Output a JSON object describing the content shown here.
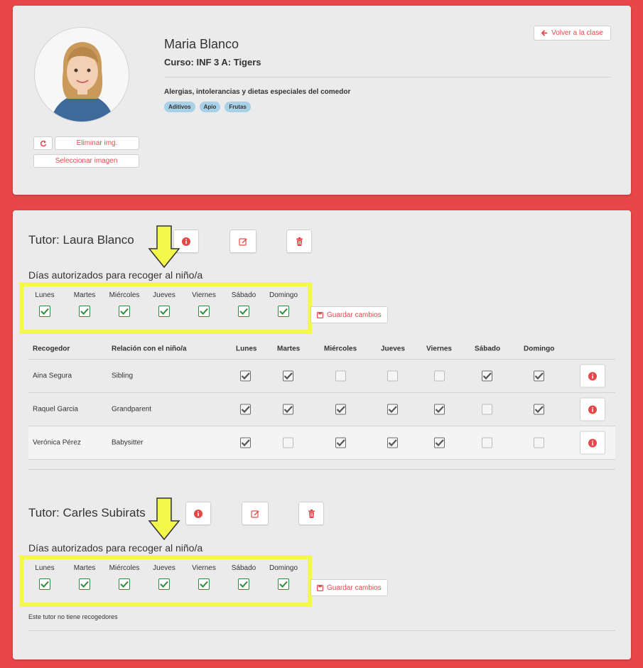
{
  "student": {
    "name": "Maria Blanco",
    "course": "Curso: INF 3 A: Tigers",
    "back_button": "Volver a la clase",
    "delete_image": "Eliminar img.",
    "select_image": "Seleccionar imagen",
    "allergies_title": "Alergias, intolerancias y dietas especiales del comedor",
    "allergies": [
      "Aditivos",
      "Apio",
      "Frutas"
    ]
  },
  "colors": {
    "accent": "#e8474a",
    "check_green": "#2e8b3a",
    "highlight": "#f4f84a",
    "tag": "#a8d0e6"
  },
  "days_title": "Días autorizados para recoger al niño/a",
  "days": [
    "Lunes",
    "Martes",
    "Miércoles",
    "Jueves",
    "Viernes",
    "Sábado",
    "Domingo"
  ],
  "save_label": "Guardar cambios",
  "table_headers": [
    "Recogedor",
    "Relación con el niño/a",
    "Lunes",
    "Martes",
    "Miércoles",
    "Jueves",
    "Viernes",
    "Sábado",
    "Domingo"
  ],
  "tutors": [
    {
      "title": "Tutor: Laura Blanco",
      "authorized_days": [
        true,
        true,
        true,
        true,
        true,
        true,
        true
      ],
      "pickers": [
        {
          "name": "Aina Segura",
          "relation": "Sibling",
          "days": [
            true,
            true,
            false,
            false,
            false,
            true,
            true
          ]
        },
        {
          "name": "Raquel Garcia",
          "relation": "Grandparent",
          "days": [
            true,
            true,
            true,
            true,
            true,
            false,
            true
          ]
        },
        {
          "name": "Verónica Pérez",
          "relation": "Babysitter",
          "days": [
            true,
            false,
            true,
            true,
            true,
            false,
            false
          ]
        }
      ]
    },
    {
      "title": "Tutor: Carles Subirats",
      "authorized_days": [
        true,
        true,
        true,
        true,
        true,
        true,
        true
      ],
      "no_pickers_text": "Este tutor no tiene recogedores"
    }
  ]
}
